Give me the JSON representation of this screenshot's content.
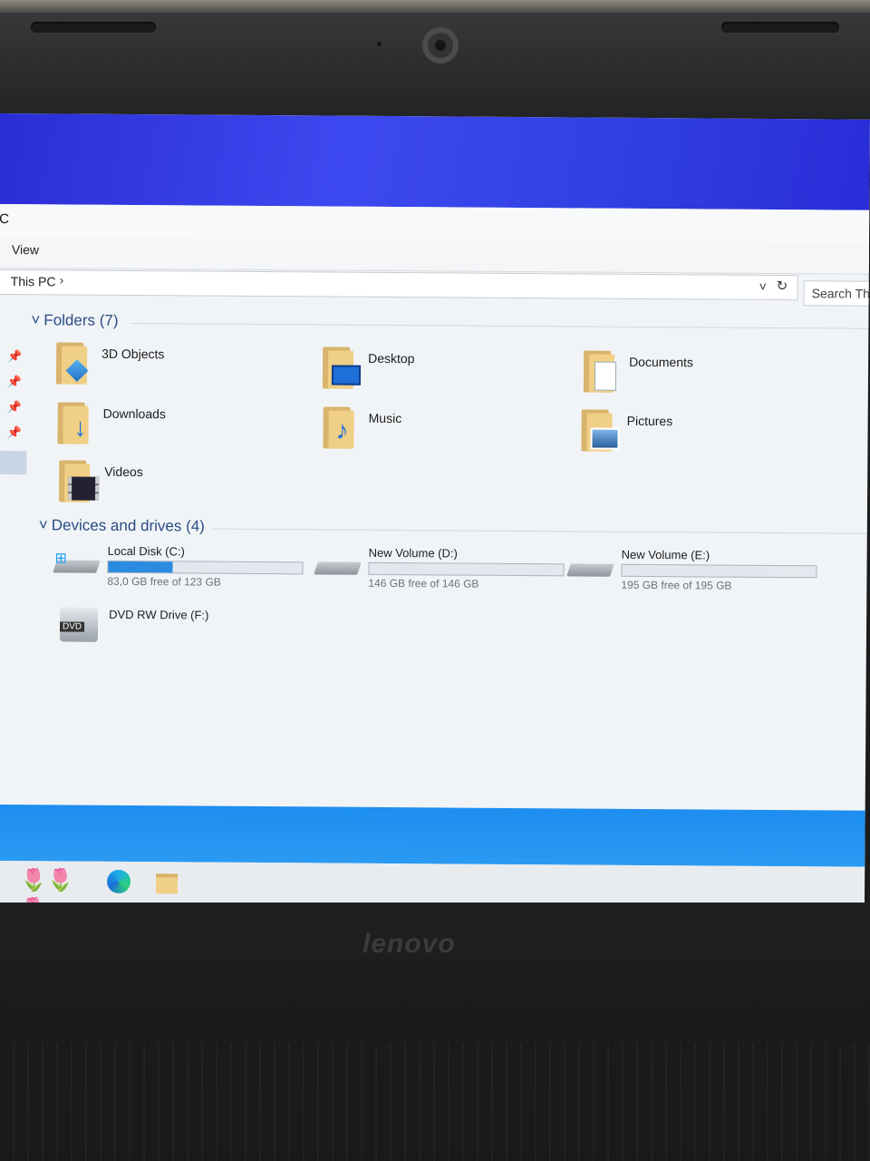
{
  "window": {
    "title_partial": "C"
  },
  "ribbon": {
    "view_label": "View"
  },
  "address": {
    "crumb": "This PC",
    "separator": "›",
    "dropdown": "˅",
    "refresh": "↻"
  },
  "search": {
    "placeholder": "Search Thi"
  },
  "folders": {
    "header": "Folders (7)",
    "items": [
      {
        "label": "3D Objects",
        "icon": "3d-objects-icon"
      },
      {
        "label": "Desktop",
        "icon": "desktop-folder-icon"
      },
      {
        "label": "Documents",
        "icon": "documents-folder-icon"
      },
      {
        "label": "Downloads",
        "icon": "downloads-folder-icon"
      },
      {
        "label": "Music",
        "icon": "music-folder-icon"
      },
      {
        "label": "Pictures",
        "icon": "pictures-folder-icon"
      },
      {
        "label": "Videos",
        "icon": "videos-folder-icon"
      }
    ]
  },
  "devices": {
    "header": "Devices and drives (4)",
    "items": [
      {
        "label": "Local Disk (C:)",
        "free_text": "83,0 GB free of 123 GB",
        "used_fraction": 0.33,
        "icon": "windows-drive-icon"
      },
      {
        "label": "New Volume (D:)",
        "free_text": "146 GB free of 146 GB",
        "used_fraction": 0.0,
        "icon": "hard-drive-icon"
      },
      {
        "label": "New Volume (E:)",
        "free_text": "195 GB free of 195 GB",
        "used_fraction": 0.0,
        "icon": "hard-drive-icon"
      },
      {
        "label": "DVD RW Drive (F:)",
        "badge": "DVD",
        "icon": "dvd-drive-icon"
      }
    ]
  },
  "taskbar": {
    "icons": [
      "tulips-icon",
      "edge-icon",
      "file-explorer-icon"
    ]
  },
  "device": {
    "brand": "lenovo"
  },
  "colors": {
    "titlebar": "#3040e2",
    "taskbar_accent": "#1d8ef0",
    "drive_fill": "#2a8be0",
    "group_header": "#2a4a86"
  }
}
